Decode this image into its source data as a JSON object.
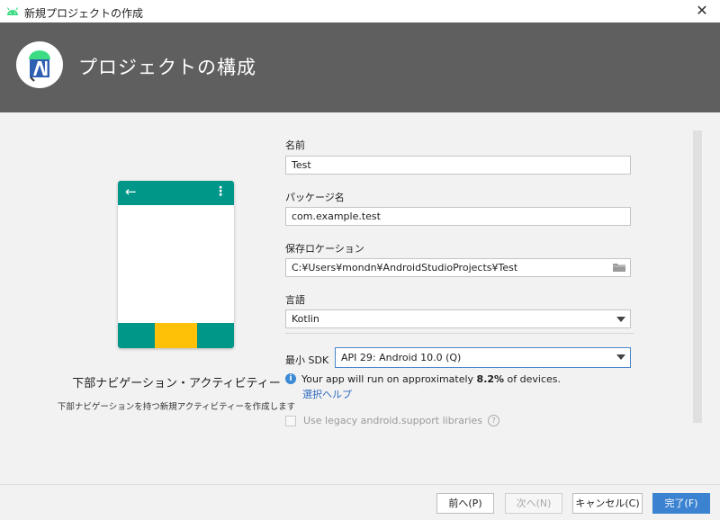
{
  "window": {
    "title": "新規プロジェクトの作成",
    "close_glyph": "✕"
  },
  "header": {
    "title": "プロジェクトの構成"
  },
  "template": {
    "name": "下部ナビゲーション・アクティビティー",
    "description": "下部ナビゲーションを持つ新規アクティビティーを作成します",
    "back_glyph": "←",
    "more_glyph": "⋮"
  },
  "form": {
    "name_label": "名前",
    "name_value": "Test",
    "package_label": "パッケージ名",
    "package_value": "com.example.test",
    "location_label": "保存ロケーション",
    "location_value": "C:¥Users¥mondn¥AndroidStudioProjects¥Test",
    "language_label": "言語",
    "language_value": "Kotlin",
    "sdk_label": "最小 SDK",
    "sdk_value": "API 29: Android 10.0 (Q)",
    "info_glyph": "i",
    "info_prefix": "Your app will run on approximately ",
    "info_percent": "8.2%",
    "info_suffix": " of devices.",
    "help_link": "選択ヘルプ",
    "legacy_label": "Use legacy android.support libraries",
    "legacy_help_glyph": "?"
  },
  "footer": {
    "prev": "前へ(P)",
    "next": "次へ(N)",
    "cancel": "キャンセル(C)",
    "finish": "完了(F)"
  },
  "colors": {
    "header_bg": "#5f5f5f",
    "teal": "#009688",
    "amber": "#ffc107",
    "primary": "#3b82d1"
  }
}
